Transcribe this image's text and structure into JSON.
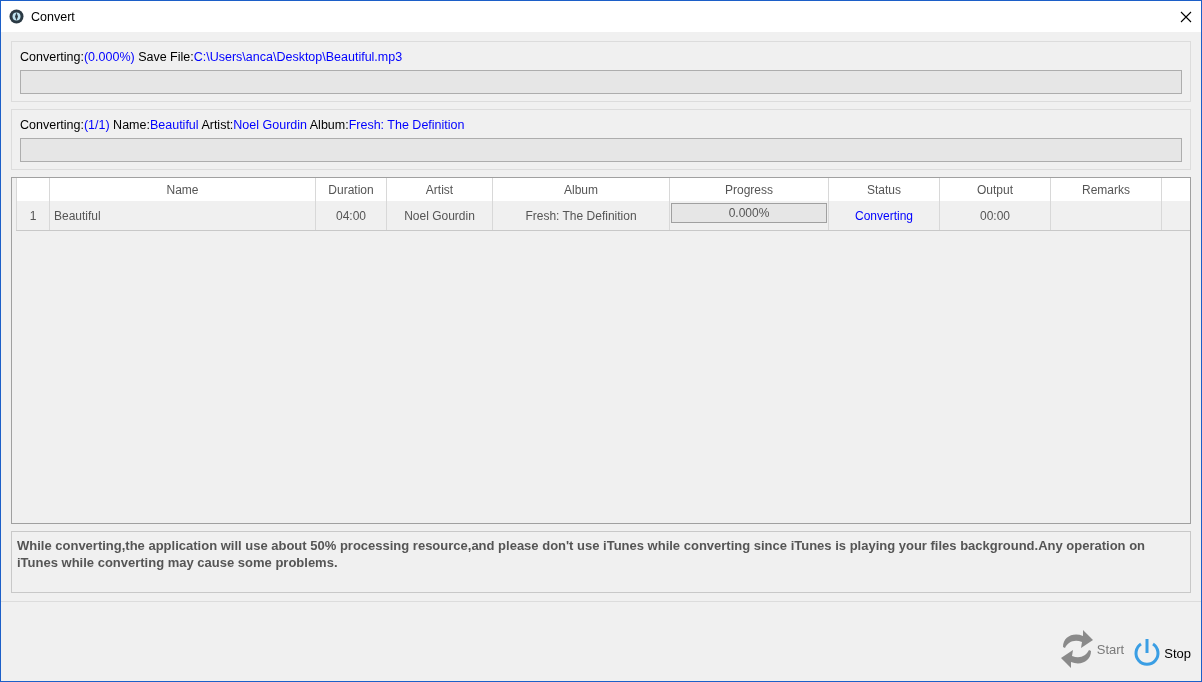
{
  "window": {
    "title": "Convert"
  },
  "file_progress": {
    "segments": [
      {
        "text": "Converting:",
        "kind": "label"
      },
      {
        "text": "(0.000%)",
        "kind": "value"
      },
      {
        "text": " Save File:",
        "kind": "label"
      },
      {
        "text": "C:\\Users\\anca\\Desktop\\Beautiful.mp3",
        "kind": "value"
      }
    ],
    "level": 0
  },
  "track_progress": {
    "segments": [
      {
        "text": "Converting:",
        "kind": "label"
      },
      {
        "text": "(1/1)",
        "kind": "value"
      },
      {
        "text": " Name:",
        "kind": "label"
      },
      {
        "text": "Beautiful",
        "kind": "value"
      },
      {
        "text": " Artist:",
        "kind": "label"
      },
      {
        "text": "Noel Gourdin",
        "kind": "value"
      },
      {
        "text": " Album:",
        "kind": "label"
      },
      {
        "text": "Fresh: The Definition",
        "kind": "value"
      }
    ],
    "level": 0
  },
  "table": {
    "columns": [
      "",
      "Name",
      "Duration",
      "Artist",
      "Album",
      "Progress",
      "Status",
      "Output",
      "Remarks"
    ],
    "rows": [
      {
        "index": "1",
        "name": "Beautiful",
        "duration": "04:00",
        "artist": "Noel Gourdin",
        "album": "Fresh: The Definition",
        "progress": {
          "text": "0.000%",
          "level": 0
        },
        "status": "Converting",
        "output": "00:00"
      }
    ]
  },
  "note": "While converting,the application will use about 50% processing resource,and please don't use iTunes while converting since iTunes is playing your files background.Any operation on iTunes while converting may cause some problems.",
  "buttons": [
    {
      "kind": "start",
      "label": "Start",
      "disabled": true
    },
    {
      "kind": "stop",
      "label": "Stop",
      "disabled": false
    }
  ]
}
